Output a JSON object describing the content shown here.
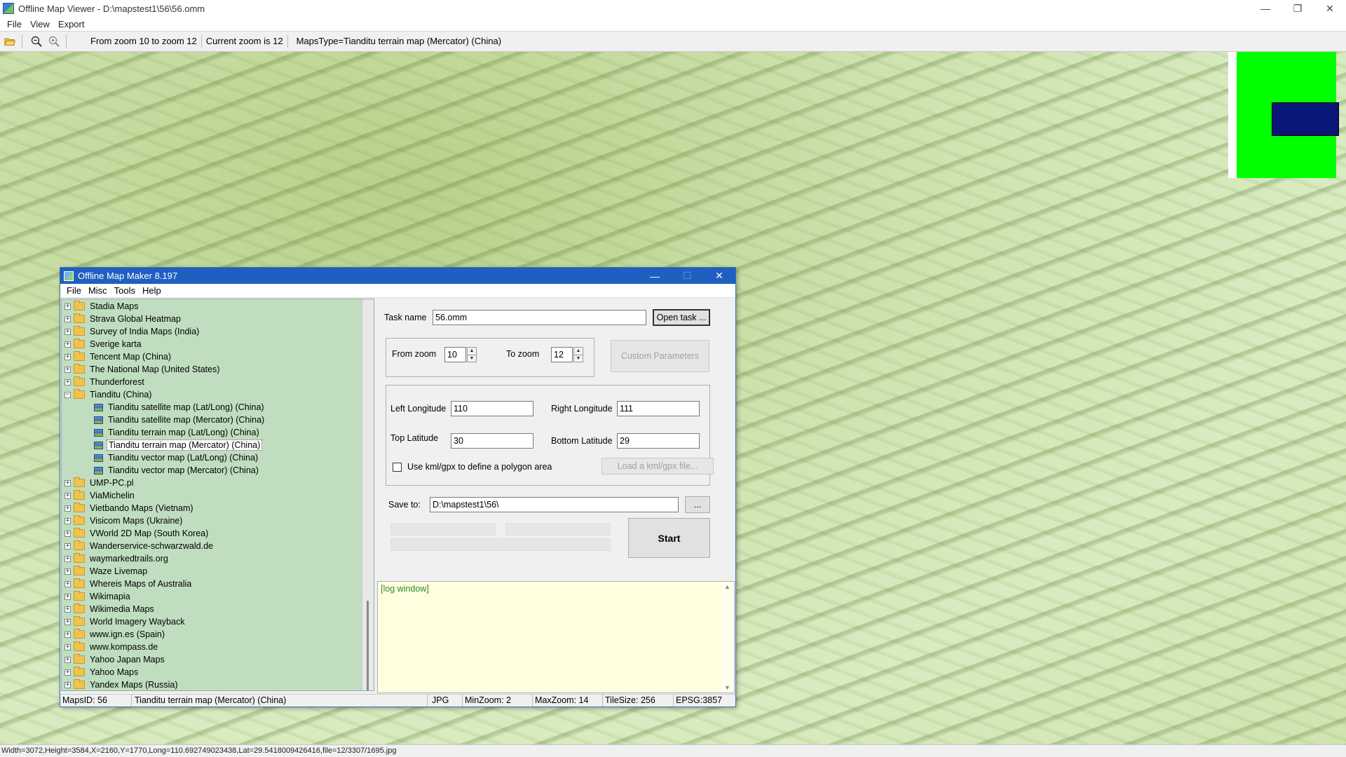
{
  "window": {
    "title": "Offline Map Viewer - D:\\mapstest1\\56\\56.omm",
    "controls": [
      "—",
      "❐",
      "✕"
    ]
  },
  "menubar": [
    "File",
    "View",
    "Export"
  ],
  "toolbar": {
    "icons": [
      "open-folder-icon",
      "zoom-out-icon",
      "zoom-in-icon"
    ],
    "zoom_range": "From zoom 10 to zoom 12",
    "current_zoom": "Current zoom is 12",
    "maps_type": "MapsType=Tianditu terrain map (Mercator) (China)"
  },
  "overview": {
    "background": "#00ff00",
    "view_color": "#0a1678"
  },
  "status": "Width=3072,Height=3584,X=2160,Y=1770,Long=110.692749023438,Lat=29.5418009426416,file=12/3307/1695.jpg",
  "dialog": {
    "title": "Offline Map Maker 8.197",
    "controls": [
      "—",
      "☐",
      "✕"
    ],
    "menu": [
      "File",
      "Misc",
      "Tools",
      "Help"
    ],
    "tree": [
      {
        "label": "Stadia Maps",
        "type": "folder",
        "exp": "+"
      },
      {
        "label": "Strava Global Heatmap",
        "type": "folder",
        "exp": "+"
      },
      {
        "label": "Survey of India Maps (India)",
        "type": "folder",
        "exp": "+"
      },
      {
        "label": "Sverige karta",
        "type": "folder",
        "exp": "+"
      },
      {
        "label": "Tencent Map (China)",
        "type": "folder",
        "exp": "+"
      },
      {
        "label": "The National Map (United States)",
        "type": "folder",
        "exp": "+"
      },
      {
        "label": "Thunderforest",
        "type": "folder",
        "exp": "+"
      },
      {
        "label": "Tianditu (China)",
        "type": "folder",
        "exp": "−"
      },
      {
        "label": "Tianditu satellite map (Lat/Long) (China)",
        "type": "leaf"
      },
      {
        "label": "Tianditu satellite map (Mercator) (China)",
        "type": "leaf"
      },
      {
        "label": "Tianditu terrain map (Lat/Long) (China)",
        "type": "leaf"
      },
      {
        "label": "Tianditu terrain map (Mercator) (China)",
        "type": "leaf",
        "selected": true
      },
      {
        "label": "Tianditu vector map (Lat/Long) (China)",
        "type": "leaf"
      },
      {
        "label": "Tianditu vector map (Mercator) (China)",
        "type": "leaf"
      },
      {
        "label": "UMP-PC.pl",
        "type": "folder",
        "exp": "+"
      },
      {
        "label": "ViaMichelin",
        "type": "folder",
        "exp": "+"
      },
      {
        "label": "Vietbando Maps (Vietnam)",
        "type": "folder",
        "exp": "+"
      },
      {
        "label": "Visicom Maps (Ukraine)",
        "type": "folder",
        "exp": "+"
      },
      {
        "label": "VWorld 2D Map (South Korea)",
        "type": "folder",
        "exp": "+"
      },
      {
        "label": "Wanderservice-schwarzwald.de",
        "type": "folder",
        "exp": "+"
      },
      {
        "label": "waymarkedtrails.org",
        "type": "folder",
        "exp": "+"
      },
      {
        "label": "Waze Livemap",
        "type": "folder",
        "exp": "+"
      },
      {
        "label": "Whereis Maps of Australia",
        "type": "folder",
        "exp": "+"
      },
      {
        "label": "Wikimapia",
        "type": "folder",
        "exp": "+"
      },
      {
        "label": "Wikimedia Maps",
        "type": "folder",
        "exp": "+"
      },
      {
        "label": "World Imagery Wayback",
        "type": "folder",
        "exp": "+"
      },
      {
        "label": "www.ign.es (Spain)",
        "type": "folder",
        "exp": "+"
      },
      {
        "label": "www.kompass.de",
        "type": "folder",
        "exp": "+"
      },
      {
        "label": "Yahoo Japan Maps",
        "type": "folder",
        "exp": "+"
      },
      {
        "label": "Yahoo Maps",
        "type": "folder",
        "exp": "+"
      },
      {
        "label": "Yandex Maps (Russia)",
        "type": "folder",
        "exp": "+"
      }
    ],
    "task_name_label": "Task name",
    "task_name_value": "56.omm",
    "open_task_button": "Open task ...",
    "from_zoom_label": "From zoom",
    "from_zoom_value": "10",
    "to_zoom_label": "To zoom",
    "to_zoom_value": "12",
    "custom_params_button": "Custom Parameters",
    "left_lon_label": "Left Longitude",
    "left_lon_value": "110",
    "right_lon_label": "Right Longitude",
    "right_lon_value": "111",
    "top_lat_label": "Top Latitude",
    "top_lat_value": "30",
    "bottom_lat_label": "Bottom Latitude",
    "bottom_lat_value": "29",
    "kml_label": "Use kml/gpx to define a polygon area",
    "kml_button": "Load a kml/gpx file...",
    "save_to_label": "Save to:",
    "save_to_value": "D:\\mapstest1\\56\\",
    "browse_button": "...",
    "start_button": "Start",
    "log_text": "[log window]",
    "statusbar": {
      "maps_id": "MapsID: 56",
      "map_name": "Tianditu terrain map (Mercator) (China)",
      "format": "JPG",
      "min_zoom": "MinZoom: 2",
      "max_zoom": "MaxZoom: 14",
      "tile_size": "TileSize: 256",
      "epsg": "EPSG:3857"
    }
  }
}
